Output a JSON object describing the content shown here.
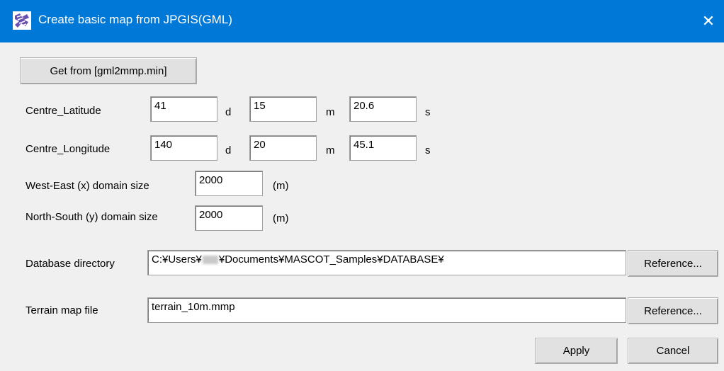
{
  "window": {
    "title": "Create basic map from JPGIS(GML)",
    "close_glyph": "✕",
    "icon": "app-logo-icon",
    "titlebar_color": "#0078d7"
  },
  "get_from_button": "Get from [gml2mmp.min]",
  "latitude": {
    "label": "Centre_Latitude",
    "deg": "41",
    "deg_unit": "d",
    "min": "15",
    "min_unit": "m",
    "sec": "20.6",
    "sec_unit": "s"
  },
  "longitude": {
    "label": "Centre_Longitude",
    "deg": "140",
    "deg_unit": "d",
    "min": "20",
    "min_unit": "m",
    "sec": "45.1",
    "sec_unit": "s"
  },
  "we_size": {
    "label": "West-East (x) domain size",
    "value": "2000",
    "unit": "(m)"
  },
  "ns_size": {
    "label": "North-South (y) domain size",
    "value": "2000",
    "unit": "(m)"
  },
  "database_dir": {
    "label": "Database directory",
    "value_prefix": "C:¥Users¥",
    "value_suffix": "¥Documents¥MASCOT_Samples¥DATABASE¥",
    "reference_button": "Reference..."
  },
  "terrain_map": {
    "label": "Terrain map file",
    "value": "terrain_10m.mmp",
    "reference_button": "Reference..."
  },
  "apply_button": "Apply",
  "cancel_button": "Cancel"
}
